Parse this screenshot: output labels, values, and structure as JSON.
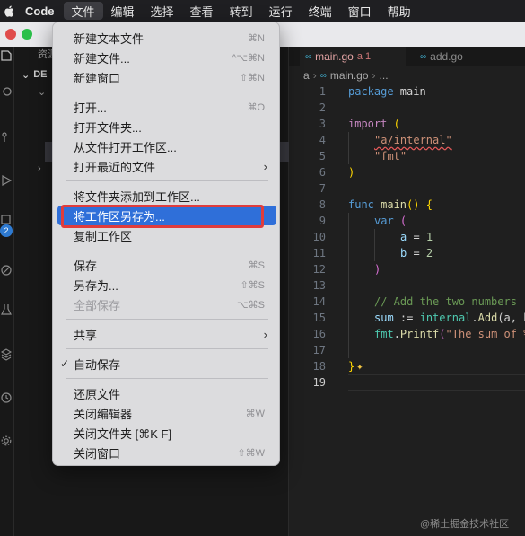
{
  "menubar": {
    "app": "Code",
    "items": [
      "文件",
      "编辑",
      "选择",
      "查看",
      "转到",
      "运行",
      "终端",
      "窗口",
      "帮助"
    ]
  },
  "sidebar": {
    "title": "资源",
    "section": "DE"
  },
  "activity": {
    "badge": "2"
  },
  "editor": {
    "tabs": [
      "main.go",
      "add.go"
    ],
    "tab1_suffix": "a 1",
    "breadcrumb": [
      "a",
      "main.go",
      "..."
    ],
    "lines": [
      {
        "n": "1"
      },
      {
        "n": "2"
      },
      {
        "n": "3"
      },
      {
        "n": "4"
      },
      {
        "n": "5"
      },
      {
        "n": "6"
      },
      {
        "n": "7"
      },
      {
        "n": "8"
      },
      {
        "n": "9"
      },
      {
        "n": "10"
      },
      {
        "n": "11"
      },
      {
        "n": "12"
      },
      {
        "n": "13"
      },
      {
        "n": "14"
      },
      {
        "n": "15"
      },
      {
        "n": "16"
      },
      {
        "n": "17"
      },
      {
        "n": "18"
      },
      {
        "n": "19"
      }
    ],
    "code": {
      "l1a": "package",
      "l1b": " main",
      "l3a": "import",
      "l3b": " (",
      "l4": "\"a/internal\"",
      "l5": "\"fmt\"",
      "l6": ")",
      "l8a": "func",
      "l8b": " main",
      "l8c": "() {",
      "l9a": "var",
      "l9b": " (",
      "l10a": "a",
      "l10b": " = ",
      "l10c": "1",
      "l11a": "b",
      "l11b": " = ",
      "l11c": "2",
      "l12": ")",
      "l14": "// Add the two numbers",
      "l15a": "sum",
      "l15b": " := ",
      "l15c": "internal",
      "l15d": ".",
      "l15e": "Add",
      "l15f": "(a, b",
      "l16a": "fmt",
      "l16b": ".",
      "l16c": "Printf",
      "l16d": "(",
      "l16e": "\"The sum of %",
      "l18": "}"
    }
  },
  "file_menu": {
    "items": [
      {
        "label": "新建文本文件",
        "shortcut": "⌘N"
      },
      {
        "label": "新建文件...",
        "shortcut": "^⌥⌘N"
      },
      {
        "label": "新建窗口",
        "shortcut": "⇧⌘N"
      },
      {
        "label": "打开...",
        "shortcut": "⌘O"
      },
      {
        "label": "打开文件夹..."
      },
      {
        "label": "从文件打开工作区..."
      },
      {
        "label": "打开最近的文件"
      },
      {
        "label": "将文件夹添加到工作区..."
      },
      {
        "label": "将工作区另存为..."
      },
      {
        "label": "复制工作区"
      },
      {
        "label": "保存",
        "shortcut": "⌘S"
      },
      {
        "label": "另存为...",
        "shortcut": "⇧⌘S"
      },
      {
        "label": "全部保存",
        "shortcut": "⌥⌘S"
      },
      {
        "label": "共享"
      },
      {
        "label": "自动保存"
      },
      {
        "label": "还原文件"
      },
      {
        "label": "关闭编辑器",
        "shortcut": "⌘W"
      },
      {
        "label": "关闭文件夹 [⌘K F]"
      },
      {
        "label": "关闭窗口",
        "shortcut": "⇧⌘W"
      }
    ]
  },
  "watermark": "@稀土掘金技术社区"
}
